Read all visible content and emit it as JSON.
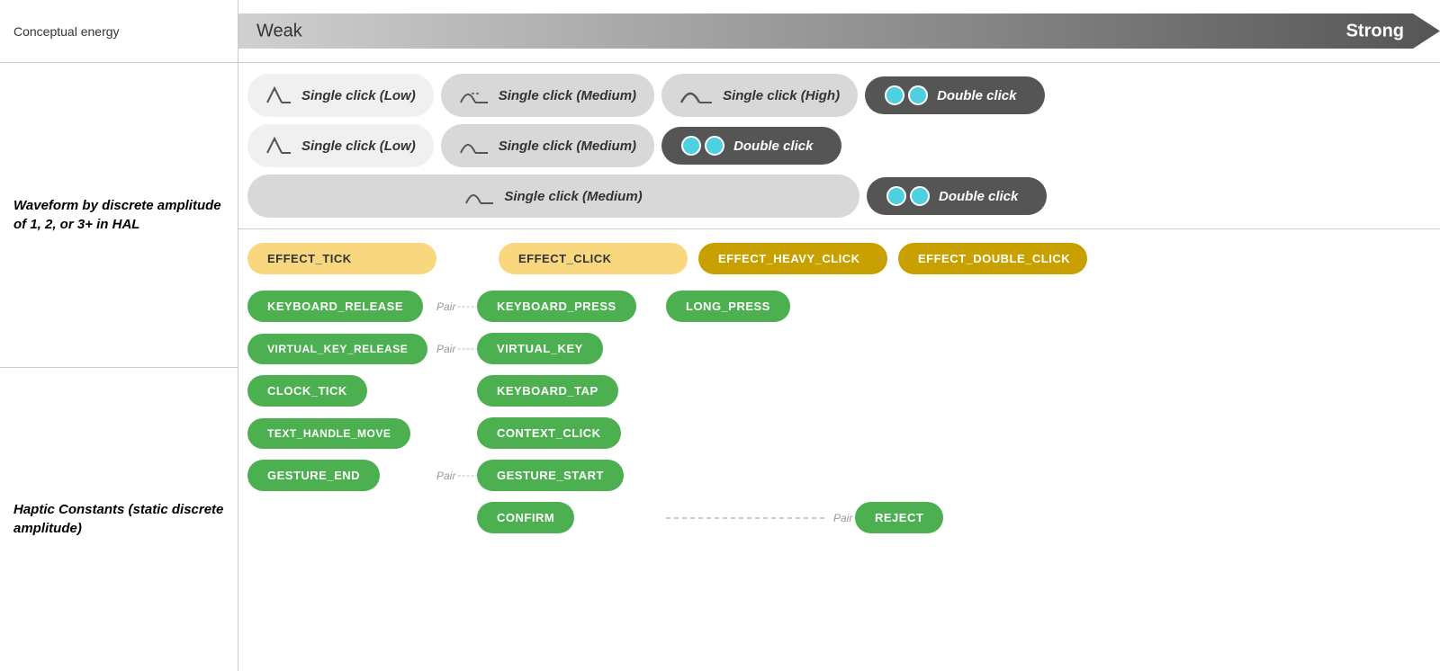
{
  "labels": {
    "conceptual_energy": "Conceptual energy",
    "weak": "Weak",
    "strong": "Strong",
    "waveform_label": "Waveform by discrete amplitude of 1, 2, or 3+ in HAL",
    "haptic_label": "Haptic Constants (static discrete amplitude)"
  },
  "waveform_rows": [
    {
      "items": [
        {
          "type": "pill_light",
          "icon": "low",
          "text": "Single click (Low)"
        },
        {
          "type": "pill_medium",
          "icon": "medium",
          "text": "Single click (Medium)"
        },
        {
          "type": "pill_medium",
          "icon": "high",
          "text": "Single click (High)"
        },
        {
          "type": "pill_dark",
          "icon": "double",
          "text": "Double click"
        }
      ]
    },
    {
      "items": [
        {
          "type": "pill_light",
          "icon": "low",
          "text": "Single click (Low)"
        },
        {
          "type": "pill_medium",
          "icon": "medium",
          "text": "Single click (Medium)"
        },
        {
          "type": "pill_dark",
          "icon": "double",
          "text": "Double click"
        }
      ]
    },
    {
      "items": [
        {
          "type": "pill_medium",
          "icon": "medium",
          "text": "Single click (Medium)"
        },
        {
          "type": "pill_dark",
          "icon": "double",
          "text": "Double click"
        }
      ]
    }
  ],
  "effects": {
    "tick": "EFFECT_TICK",
    "click": "EFFECT_CLICK",
    "heavy_click": "EFFECT_HEAVY_CLICK",
    "double_click": "EFFECT_DOUBLE_CLICK"
  },
  "constants": {
    "col1": [
      "KEYBOARD_RELEASE",
      "VIRTUAL_KEY_RELEASE",
      "CLOCK_TICK",
      "TEXT_HANDLE_MOVE",
      "GESTURE_END"
    ],
    "col2": [
      "KEYBOARD_PRESS",
      "VIRTUAL_KEY",
      "KEYBOARD_TAP",
      "CONTEXT_CLICK",
      "GESTURE_START"
    ],
    "col3": [
      "LONG_PRESS"
    ],
    "paired": [
      true,
      true,
      false,
      false,
      true
    ],
    "confirm": "CONFIRM",
    "reject": "REJECT"
  },
  "pair_label": "Pair"
}
